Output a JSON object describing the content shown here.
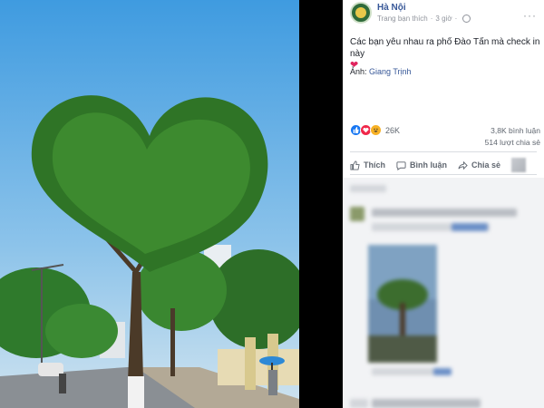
{
  "post": {
    "page_name": "Hà Nội",
    "subtitle": "Trang bạn thích",
    "time": "3 giờ",
    "caption": "Các bạn yêu nhau ra phố Đào Tấn mà check in này",
    "credit_prefix": "Ảnh:",
    "credit_name": "Giang Trịnh"
  },
  "reactions": {
    "count": "26K",
    "comments": "3,8K bình luận",
    "shares": "514 lượt chia sẻ"
  },
  "actions": {
    "like": "Thích",
    "comment": "Bình luận",
    "share": "Chia sẻ"
  },
  "icons": [
    "globe-icon",
    "more-options-icon",
    "like-icon",
    "comment-icon",
    "share-icon",
    "heart-icon",
    "haha-icon",
    "love-icon"
  ],
  "colors": {
    "link": "#385898",
    "meta": "#90949c",
    "like_blue": "#1877f2",
    "love_red": "#f0284a"
  }
}
